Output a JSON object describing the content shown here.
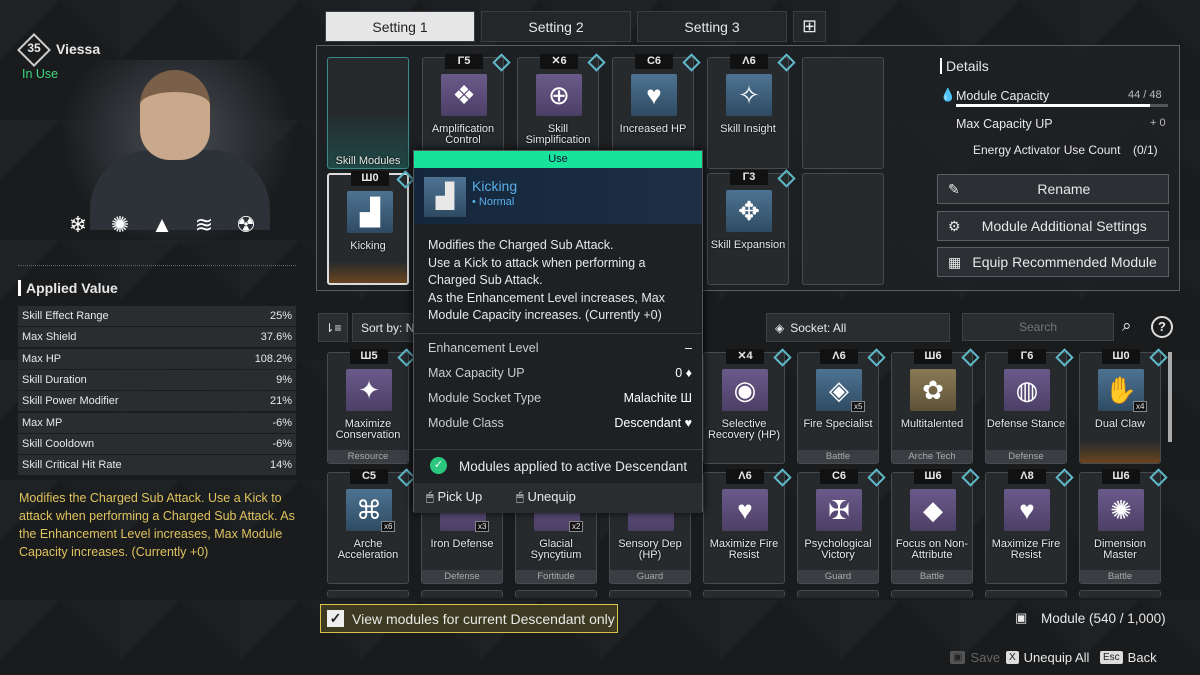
{
  "character": {
    "level": "35",
    "name": "Viessa",
    "status": "In Use",
    "skill_icons": [
      "❄",
      "✺",
      "▲",
      "≋",
      "☢"
    ]
  },
  "applied_value": {
    "title": "Applied Value",
    "rows": [
      {
        "label": "Skill Effect Range",
        "value": "25%"
      },
      {
        "label": "Max Shield",
        "value": "37.6%"
      },
      {
        "label": "Max HP",
        "value": "108.2%"
      },
      {
        "label": "Skill Duration",
        "value": "9%"
      },
      {
        "label": "Skill Power Modifier",
        "value": "21%"
      },
      {
        "label": "Max MP",
        "value": "-6%"
      },
      {
        "label": "Skill Cooldown",
        "value": "-6%"
      },
      {
        "label": "Skill Critical Hit Rate",
        "value": "14%"
      }
    ]
  },
  "description": "Modifies the Charged Sub Attack. Use a Kick to attack when performing a Charged Sub Attack. As the Enhancement Level increases, Max Module Capacity increases. (Currently +0)",
  "tabs": [
    {
      "label": "Setting 1",
      "active": true
    },
    {
      "label": "Setting 2"
    },
    {
      "label": "Setting 3"
    }
  ],
  "equipped": [
    {
      "name": "Skill Modules",
      "empty": true,
      "skill": true
    },
    {
      "name": "Amplification Control",
      "cap": "Γ5",
      "color": "purple",
      "icon": "❖"
    },
    {
      "name": "Skill Simplification",
      "cap": "✕6",
      "color": "purple",
      "icon": "⊕"
    },
    {
      "name": "Increased HP",
      "cap": "C6",
      "color": "blue",
      "icon": "♥"
    },
    {
      "name": "Skill Insight",
      "cap": "Λ6",
      "color": "blue",
      "icon": "✧"
    },
    {
      "name": "",
      "empty": true
    },
    {
      "name": "Kicking",
      "cap": "Ш0",
      "color": "blue",
      "icon": "▟",
      "selected": true
    },
    {
      "name": "",
      "hidden": true
    },
    {
      "name": "",
      "hidden": true
    },
    {
      "name": "",
      "hidden": true
    },
    {
      "name": "Skill Expansion",
      "cap": "Γ3",
      "color": "blue",
      "icon": "✥"
    },
    {
      "name": "",
      "empty": true
    }
  ],
  "details": {
    "title": "Details",
    "capacity_label": "Module Capacity",
    "capacity_value": "44 / 48",
    "capacity_fraction": 0.917,
    "max_up_label": "Max Capacity UP",
    "max_up_value": "+ 0",
    "activator_label": "Energy Activator Use Count",
    "activator_value": "(0/1)",
    "buttons": [
      "Rename",
      "Module Additional Settings",
      "Equip Recommended Module"
    ]
  },
  "sort": {
    "label": "Sort by: N",
    "socket": "Socket: All",
    "search_placeholder": "Search",
    "help": "?"
  },
  "modules": [
    {
      "name": "Maximize Conservation",
      "cap": "Ш5",
      "cls": "Resource",
      "color": "purple",
      "icon": "✦"
    },
    {
      "name": "",
      "hidden": true
    },
    {
      "name": "",
      "hidden": true
    },
    {
      "name": "",
      "hidden": true
    },
    {
      "name": "Selective Recovery (HP)",
      "cap": "✕4",
      "cls": "",
      "color": "purple",
      "icon": "◉"
    },
    {
      "name": "Fire Specialist",
      "cap": "Λ6",
      "cls": "Battle",
      "color": "blue",
      "icon": "◈",
      "count": "x5"
    },
    {
      "name": "Multitalented",
      "cap": "Ш6",
      "cls": "Arche Tech",
      "color": "gold",
      "icon": "✿"
    },
    {
      "name": "Defense Stance",
      "cap": "Γ6",
      "cls": "Defense",
      "color": "purple",
      "icon": "◍"
    },
    {
      "name": "Dual Claw",
      "cap": "Ш0",
      "cls": "",
      "color": "blue",
      "icon": "✋",
      "count": "x4",
      "orange": true
    },
    {
      "name": "Arche Acceleration",
      "cap": "C5",
      "cls": "",
      "color": "blue",
      "icon": "⌘",
      "count": "x6"
    },
    {
      "name": "Iron Defense",
      "cap": "",
      "cls": "Defense",
      "color": "purple",
      "icon": "",
      "count": "x3"
    },
    {
      "name": "Glacial Syncytium",
      "cap": "",
      "cls": "Fortitude",
      "color": "purple",
      "icon": "",
      "count": "x2"
    },
    {
      "name": "Sensory Dep (HP)",
      "cap": "",
      "cls": "Guard",
      "color": "purple",
      "icon": ""
    },
    {
      "name": "Maximize Fire Resist",
      "cap": "Λ6",
      "cls": "",
      "color": "purple",
      "icon": "♥"
    },
    {
      "name": "Psychological Victory",
      "cap": "C6",
      "cls": "Guard",
      "color": "purple",
      "icon": "✠"
    },
    {
      "name": "Focus on Non-Attribute",
      "cap": "Ш6",
      "cls": "Battle",
      "color": "purple",
      "icon": "◆"
    },
    {
      "name": "Maximize Fire Resist",
      "cap": "Λ8",
      "cls": "",
      "color": "purple",
      "icon": "♥"
    },
    {
      "name": "Dimension Master",
      "cap": "Ш6",
      "cls": "Battle",
      "color": "purple",
      "icon": "✺"
    }
  ],
  "tooltip": {
    "header": "Use",
    "name": "Kicking",
    "rarity": "• Normal",
    "lines": [
      "Modifies the Charged Sub Attack.",
      "Use a Kick to attack when performing a",
      "Charged Sub Attack.",
      "As the Enhancement Level increases, Max",
      "Module Capacity increases. (Currently +0)"
    ],
    "stats": [
      {
        "label": "Enhancement Level",
        "value": "–"
      },
      {
        "label": "Max Capacity UP",
        "value": "0 ♦"
      },
      {
        "label": "Module Socket Type",
        "value": "Malachite Ш"
      },
      {
        "label": "Module Class",
        "value": "Descendant ♥"
      }
    ],
    "applied": "Modules applied to active Descendant",
    "pickup": "Pick Up",
    "unequip": "Unequip"
  },
  "filter_checkbox": {
    "label": "View modules for current Descendant only",
    "checked": true
  },
  "inventory": "Module (540 / 1,000)",
  "footer": {
    "save": "Save",
    "unequip_all": "Unequip All",
    "unequip_key": "X",
    "back": "Back",
    "back_key": "Esc"
  },
  "colors": {
    "accent_green": "#18e39a",
    "desc_yellow": "#e0c35e",
    "tooltip_blue": "#5aaee8"
  }
}
